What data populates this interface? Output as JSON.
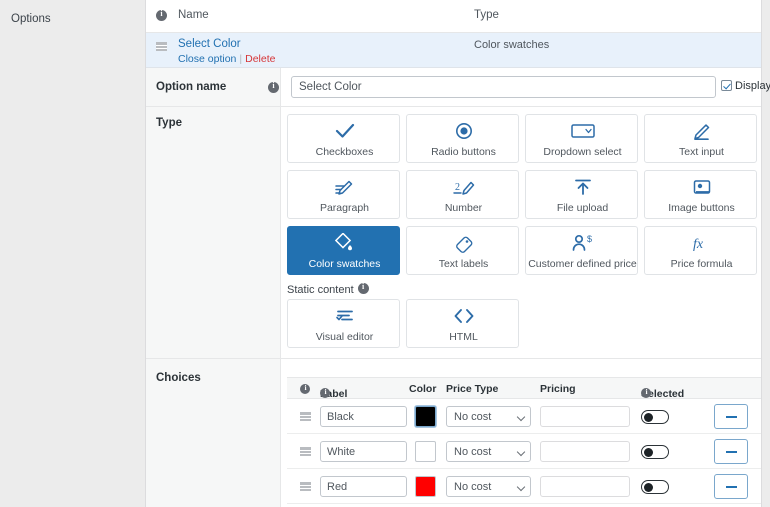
{
  "gutter": {
    "title": "Options"
  },
  "options_table": {
    "header": {
      "info_icon": "info-icon",
      "name": "Name",
      "type": "Type"
    },
    "row": {
      "name": "Select Color",
      "close_label": "Close option",
      "separator": "|",
      "delete_label": "Delete",
      "type": "Color swatches"
    }
  },
  "option_name": {
    "label": "Option name",
    "value": "Select Color",
    "placeholder": "Select Color",
    "display_label": "Display",
    "display_checked": true
  },
  "type_section": {
    "label": "Type",
    "selected": "Color swatches",
    "tiles": [
      {
        "label": "Checkboxes",
        "icon": "checkmark-icon"
      },
      {
        "label": "Radio buttons",
        "icon": "radio-icon"
      },
      {
        "label": "Dropdown select",
        "icon": "dropdown-icon"
      },
      {
        "label": "Text input",
        "icon": "pencil-icon"
      },
      {
        "label": "Paragraph",
        "icon": "pencil-lines-icon"
      },
      {
        "label": "Number",
        "icon": "number-pencil-icon"
      },
      {
        "label": "File upload",
        "icon": "upload-arrow-icon"
      },
      {
        "label": "Image buttons",
        "icon": "image-icon"
      },
      {
        "label": "Color swatches",
        "icon": "color-swatch-icon"
      },
      {
        "label": "Text labels",
        "icon": "tag-icon"
      },
      {
        "label": "Customer defined price",
        "icon": "person-dollar-icon"
      },
      {
        "label": "Price formula",
        "icon": "fx-icon"
      }
    ],
    "static_content_label": "Static content",
    "static_tiles": [
      {
        "label": "Visual editor",
        "icon": "visual-editor-icon"
      },
      {
        "label": "HTML",
        "icon": "code-brackets-icon"
      }
    ]
  },
  "choices": {
    "label": "Choices",
    "columns": {
      "info": "info-icon",
      "label": "Label",
      "color": "Color",
      "price_type": "Price Type",
      "pricing": "Pricing",
      "selected": "Selected"
    },
    "rows": [
      {
        "label": "Black",
        "color": "#000000",
        "price_type": "No cost",
        "pricing": "",
        "selected": false,
        "remove_label": "-"
      },
      {
        "label": "White",
        "color": "#ffffff",
        "price_type": "No cost",
        "pricing": "",
        "selected": false,
        "remove_label": "-"
      },
      {
        "label": "Red",
        "color": "#ff0000",
        "price_type": "No cost",
        "pricing": "",
        "selected": false,
        "remove_label": "-"
      }
    ]
  },
  "colors": {
    "accent": "#2271b1",
    "danger": "#d63638",
    "row_highlight": "#e8f1fb",
    "panel_bg": "#ffffff",
    "page_bg": "#ececec"
  }
}
